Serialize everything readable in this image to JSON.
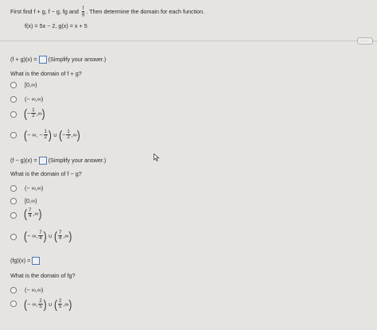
{
  "header": {
    "instruction_pre": "First find f + g, f − g, fg and",
    "frac_num": "f",
    "frac_den": "g",
    "instruction_post": ". Then determine the domain for each function.",
    "functions": "f(x) = 5x − 2, g(x) = x + 5"
  },
  "more_button": ".....",
  "part1": {
    "lhs": "(f + g)(x) =",
    "hint": "(Simplify your answer.)",
    "question": "What is the domain of f + g?",
    "options": {
      "a": "[0,∞)",
      "b": "(− ∞,∞)",
      "c": {
        "lp": "(",
        "pre": "−",
        "num": "1",
        "den": "2",
        "post": ",∞",
        "rp": ")"
      },
      "d": {
        "lp1": "(",
        "pre1": "− ∞, −",
        "num1": "1",
        "den1": "2",
        "rp1": ")",
        "union": "∪",
        "lp2": "(",
        "pre2": "−",
        "num2": "1",
        "den2": "2",
        "post2": ",∞",
        "rp2": ")"
      }
    }
  },
  "part2": {
    "lhs": "(f − g)(x) =",
    "hint": "(Simplify your answer.)",
    "question": "What is the domain of f − g?",
    "options": {
      "a": "(− ∞,∞)",
      "b": "[0,∞)",
      "c": {
        "lp": "(",
        "num": "7",
        "den": "4",
        "post": ",∞",
        "rp": ")"
      },
      "d": {
        "lp1": "(",
        "pre1": "− ∞,",
        "num1": "7",
        "den1": "4",
        "rp1": ")",
        "union": "∪",
        "lp2": "(",
        "num2": "7",
        "den2": "4",
        "post2": ",∞",
        "rp2": ")"
      }
    }
  },
  "part3": {
    "lhs": "(fg)(x) =",
    "question": "What is the domain of fg?",
    "options": {
      "a": "(− ∞,∞)",
      "b": {
        "lp1": "(",
        "pre1": "− ∞,",
        "num1": "2",
        "den1": "5",
        "rp1": ")",
        "union": "∪",
        "lp2": "(",
        "num2": "2",
        "den2": "5",
        "post2": ",∞",
        "rp2": ")"
      }
    }
  }
}
